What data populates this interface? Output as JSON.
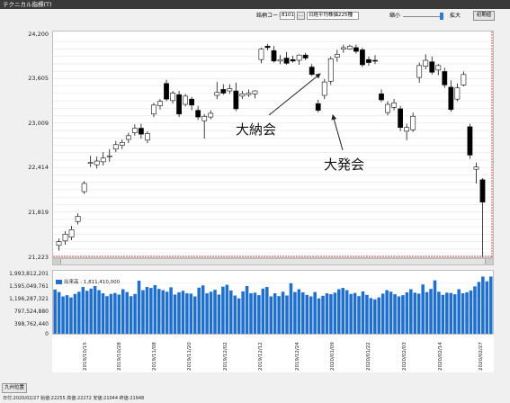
{
  "window": {
    "title": "テクニカル指標(T)"
  },
  "toolbar": {
    "code_label": "銘柄コード:",
    "code_value": "8101",
    "ellipsis": "...",
    "index_value": "日経平均株価225種",
    "shrink_label": "縮小",
    "expand_label": "拡大",
    "initial_button": "初期値"
  },
  "price_axis": {
    "ticks": [
      "24,200",
      "23,605",
      "23,009",
      "22,414",
      "21,819",
      "21,223"
    ]
  },
  "volume_axis": {
    "ticks": [
      "1,993,812,201",
      "1,595,049,761",
      "1,196,287,321",
      "797,524,880",
      "398,762,440",
      "0"
    ]
  },
  "legend": {
    "label": "出来高 : 1,811,410,000"
  },
  "annotations": {
    "daino": "大納会",
    "daihakkai": "大発会"
  },
  "dates": [
    "2019/10/15",
    "2019/10/28",
    "2019/11/08",
    "2019/11/20",
    "2019/12/02",
    "2019/12/12",
    "2019/12/24",
    "2020/01/09",
    "2020/01/22",
    "2020/02/03",
    "2020/02/14",
    "2020/02/27"
  ],
  "footer": {
    "button": "九州位置",
    "status": "日付:2020/02/27 始値:22255 高値:22272 安値:21044 終値:21948"
  },
  "colors": {
    "up": "#ffffff",
    "down": "#000000",
    "volume": "#1e6fd0",
    "red_border": "#d04a4a"
  },
  "chart_data": {
    "type": "candlestick",
    "price_ylim": [
      21223,
      24200
    ],
    "volume_ylim": [
      0,
      1993812201
    ],
    "candles": [
      {
        "o": 21370,
        "h": 21460,
        "l": 21300,
        "c": 21420
      },
      {
        "o": 21430,
        "h": 21560,
        "l": 21380,
        "c": 21520
      },
      {
        "o": 21480,
        "h": 21630,
        "l": 21440,
        "c": 21580
      },
      {
        "o": 21690,
        "h": 21800,
        "l": 21650,
        "c": 21760
      },
      {
        "o": 22090,
        "h": 22230,
        "l": 22060,
        "c": 22200
      },
      {
        "o": 22470,
        "h": 22570,
        "l": 22420,
        "c": 22480
      },
      {
        "o": 22450,
        "h": 22560,
        "l": 22400,
        "c": 22500
      },
      {
        "o": 22490,
        "h": 22620,
        "l": 22440,
        "c": 22540
      },
      {
        "o": 22560,
        "h": 22660,
        "l": 22490,
        "c": 22570
      },
      {
        "o": 22660,
        "h": 22770,
        "l": 22620,
        "c": 22720
      },
      {
        "o": 22710,
        "h": 22790,
        "l": 22660,
        "c": 22750
      },
      {
        "o": 22790,
        "h": 22880,
        "l": 22740,
        "c": 22840
      },
      {
        "o": 22880,
        "h": 22990,
        "l": 22840,
        "c": 22940
      },
      {
        "o": 22940,
        "h": 23000,
        "l": 22800,
        "c": 22860
      },
      {
        "o": 22780,
        "h": 22900,
        "l": 22740,
        "c": 22870
      },
      {
        "o": 23130,
        "h": 23280,
        "l": 23090,
        "c": 23250
      },
      {
        "o": 23240,
        "h": 23330,
        "l": 23190,
        "c": 23300
      },
      {
        "o": 23540,
        "h": 23590,
        "l": 23300,
        "c": 23330
      },
      {
        "o": 23310,
        "h": 23440,
        "l": 23270,
        "c": 23410
      },
      {
        "o": 23390,
        "h": 23440,
        "l": 23090,
        "c": 23130
      },
      {
        "o": 23260,
        "h": 23400,
        "l": 23230,
        "c": 23370
      },
      {
        "o": 23330,
        "h": 23360,
        "l": 23180,
        "c": 23250
      },
      {
        "o": 23180,
        "h": 23240,
        "l": 23050,
        "c": 23090
      },
      {
        "o": 23040,
        "h": 23130,
        "l": 22800,
        "c": 23100
      },
      {
        "o": 23090,
        "h": 23180,
        "l": 23060,
        "c": 23140
      },
      {
        "o": 23380,
        "h": 23560,
        "l": 23330,
        "c": 23420
      },
      {
        "o": 23460,
        "h": 23530,
        "l": 23390,
        "c": 23410
      },
      {
        "o": 23440,
        "h": 23530,
        "l": 23400,
        "c": 23470
      },
      {
        "o": 23440,
        "h": 23550,
        "l": 23170,
        "c": 23200
      },
      {
        "o": 23370,
        "h": 23440,
        "l": 23330,
        "c": 23400
      },
      {
        "o": 23390,
        "h": 23460,
        "l": 23360,
        "c": 23410
      },
      {
        "o": 23400,
        "h": 23450,
        "l": 23340,
        "c": 23440
      },
      {
        "o": 23860,
        "h": 24020,
        "l": 23810,
        "c": 24000
      },
      {
        "o": 24040,
        "h": 24070,
        "l": 23980,
        "c": 24020
      },
      {
        "o": 23980,
        "h": 24040,
        "l": 23820,
        "c": 23840
      },
      {
        "o": 23840,
        "h": 23920,
        "l": 23800,
        "c": 23860
      },
      {
        "o": 23880,
        "h": 23960,
        "l": 23790,
        "c": 23810
      },
      {
        "o": 23860,
        "h": 23910,
        "l": 23820,
        "c": 23840
      },
      {
        "o": 23850,
        "h": 23930,
        "l": 23790,
        "c": 23920
      },
      {
        "o": 23920,
        "h": 23950,
        "l": 23850,
        "c": 23880
      },
      {
        "o": 23760,
        "h": 23800,
        "l": 23640,
        "c": 23660
      },
      {
        "o": 23270,
        "h": 23320,
        "l": 23150,
        "c": 23180
      },
      {
        "o": 23380,
        "h": 23600,
        "l": 23330,
        "c": 23560
      },
      {
        "o": 23570,
        "h": 23900,
        "l": 23520,
        "c": 23870
      },
      {
        "o": 23890,
        "h": 23990,
        "l": 23830,
        "c": 23930
      },
      {
        "o": 24000,
        "h": 24060,
        "l": 23950,
        "c": 24020
      },
      {
        "o": 24000,
        "h": 24060,
        "l": 23990,
        "c": 24040
      },
      {
        "o": 24020,
        "h": 24060,
        "l": 23940,
        "c": 23970
      },
      {
        "o": 23990,
        "h": 24020,
        "l": 23760,
        "c": 23790
      },
      {
        "o": 23860,
        "h": 23900,
        "l": 23780,
        "c": 23820
      },
      {
        "o": 23850,
        "h": 23920,
        "l": 23800,
        "c": 23840
      },
      {
        "o": 23400,
        "h": 23460,
        "l": 23290,
        "c": 23320
      },
      {
        "o": 23150,
        "h": 23300,
        "l": 23110,
        "c": 23260
      },
      {
        "o": 23220,
        "h": 23330,
        "l": 23180,
        "c": 23280
      },
      {
        "o": 23200,
        "h": 23240,
        "l": 22900,
        "c": 22950
      },
      {
        "o": 22900,
        "h": 23000,
        "l": 22780,
        "c": 22950
      },
      {
        "o": 22920,
        "h": 23150,
        "l": 22890,
        "c": 23100
      },
      {
        "o": 23620,
        "h": 23820,
        "l": 23550,
        "c": 23780
      },
      {
        "o": 23770,
        "h": 23930,
        "l": 23730,
        "c": 23850
      },
      {
        "o": 23830,
        "h": 23900,
        "l": 23660,
        "c": 23690
      },
      {
        "o": 23720,
        "h": 23800,
        "l": 23650,
        "c": 23780
      },
      {
        "o": 23700,
        "h": 23750,
        "l": 23480,
        "c": 23520
      },
      {
        "o": 23490,
        "h": 23580,
        "l": 23160,
        "c": 23190
      },
      {
        "o": 23330,
        "h": 23540,
        "l": 23300,
        "c": 23480
      },
      {
        "o": 23520,
        "h": 23700,
        "l": 23500,
        "c": 23660
      },
      {
        "o": 22960,
        "h": 23000,
        "l": 22530,
        "c": 22580
      },
      {
        "o": 22390,
        "h": 22480,
        "l": 22200,
        "c": 22420
      },
      {
        "o": 22250,
        "h": 22270,
        "l": 21040,
        "c": 21950
      }
    ],
    "volumes": [
      1400000000,
      1320000000,
      1180000000,
      1220000000,
      1150000000,
      1260000000,
      1330000000,
      1480000000,
      1360000000,
      1430000000,
      1510000000,
      1380000000,
      1280000000,
      1190000000,
      1260000000,
      1290000000,
      1240000000,
      1410000000,
      1320000000,
      1190000000,
      1260000000,
      1680000000,
      1380000000,
      1480000000,
      1450000000,
      1540000000,
      1420000000,
      1380000000,
      1330000000,
      1470000000,
      1240000000,
      1310000000,
      1360000000,
      1280000000,
      1270000000,
      1180000000,
      1460000000,
      1530000000,
      1280000000,
      1330000000,
      1390000000,
      1240000000,
      1490000000,
      1550000000,
      1370000000,
      1210000000,
      1120000000,
      1340000000,
      1510000000,
      1280000000,
      1300000000,
      1220000000,
      1430000000,
      1480000000,
      1180000000,
      1280000000,
      1190000000,
      1330000000,
      1210000000,
      1600000000,
      1320000000,
      1410000000,
      1310000000,
      1230000000,
      1180000000,
      1320000000,
      1120000000,
      1200000000,
      1280000000,
      1250000000,
      1300000000,
      1410000000,
      1450000000,
      1380000000,
      1260000000,
      1290000000,
      1190000000,
      1340000000,
      1230000000,
      1130000000,
      1090000000,
      1150000000,
      1270000000,
      1380000000,
      1330000000,
      1250000000,
      1180000000,
      1220000000,
      1310000000,
      1410000000,
      1300000000,
      1270000000,
      1560000000,
      1320000000,
      1420000000,
      1690000000,
      1330000000,
      1230000000,
      1300000000,
      1290000000,
      1250000000,
      1410000000,
      1280000000,
      1310000000,
      1370000000,
      1500000000,
      1640000000,
      1810000000,
      1660000000,
      1811410000
    ]
  }
}
